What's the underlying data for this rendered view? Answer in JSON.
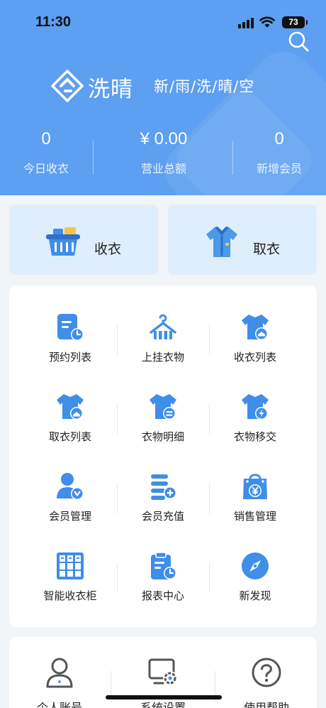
{
  "status_bar": {
    "time": "11:30",
    "battery": "73"
  },
  "header": {
    "brand_name": "洗晴",
    "slogan": "新/雨/洗/晴/空"
  },
  "stats": [
    {
      "value": "0",
      "label": "今日收衣"
    },
    {
      "value": "¥ 0.00",
      "label": "营业总额"
    },
    {
      "value": "0",
      "label": "新增会员"
    }
  ],
  "quick_actions": [
    {
      "label": "收衣",
      "icon": "laundry-basket-icon"
    },
    {
      "label": "取衣",
      "icon": "shirt-icon"
    }
  ],
  "grid": [
    {
      "label": "预约列表",
      "icon": "appointment-list-icon"
    },
    {
      "label": "上挂衣物",
      "icon": "hanger-icon"
    },
    {
      "label": "收衣列表",
      "icon": "receive-list-icon"
    },
    {
      "label": "取衣列表",
      "icon": "pickup-list-icon"
    },
    {
      "label": "衣物明细",
      "icon": "clothing-detail-icon"
    },
    {
      "label": "衣物移交",
      "icon": "clothing-transfer-icon"
    },
    {
      "label": "会员管理",
      "icon": "member-manage-icon"
    },
    {
      "label": "会员充值",
      "icon": "member-recharge-icon"
    },
    {
      "label": "销售管理",
      "icon": "sales-bag-icon"
    },
    {
      "label": "智能收衣柜",
      "icon": "smart-locker-icon"
    },
    {
      "label": "报表中心",
      "icon": "report-center-icon"
    },
    {
      "label": "新发现",
      "icon": "compass-icon"
    }
  ],
  "bottom": [
    {
      "label": "个人账号",
      "icon": "user-account-icon"
    },
    {
      "label": "系统设置",
      "icon": "system-settings-icon"
    },
    {
      "label": "使用帮助",
      "icon": "help-icon"
    }
  ],
  "colors": {
    "primary": "#5d9ff0",
    "icon_blue": "#3f8ee8",
    "card_tint": "#dfeefc"
  }
}
